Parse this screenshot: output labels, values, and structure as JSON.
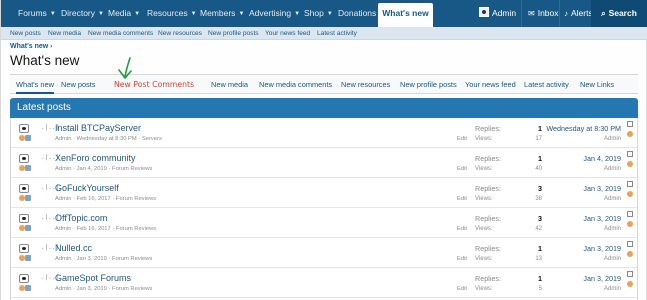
{
  "nav": {
    "items": [
      "Forums",
      "Directory",
      "Media",
      "Resources",
      "Members",
      "Advertising",
      "Shop",
      "Donations"
    ],
    "active": "What's new",
    "user": "Admin",
    "inbox": "Inbox",
    "alerts": "Alerts",
    "search": "Search"
  },
  "subnav": [
    "New posts",
    "New media",
    "New media comments",
    "New resources",
    "New profile posts",
    "Your news feed",
    "Latest activity"
  ],
  "breadcrumb": "What's new",
  "page_title": "What's new",
  "tabs": [
    "What's new",
    "New posts",
    "New media",
    "New media comments",
    "New resources",
    "New profile posts",
    "Your news feed",
    "Latest activity",
    "New Links"
  ],
  "annotation": "New Post Comments",
  "block_title": "Latest posts",
  "labels": {
    "replies": "Replies:",
    "views": "Views:",
    "edit": "Edit"
  },
  "threads": [
    {
      "prefix": ".|..|",
      "title": "Install BTCPayServer",
      "meta": "Admin · Wednesday at 8:30 PM · Servers",
      "replies": "1",
      "views": "17",
      "last_date": "Wednesday at 8:30 PM",
      "last_user": "Admin"
    },
    {
      "prefix": ".|..|",
      "title": "XenForo community",
      "meta": "Admin · Jan 4, 2019 · Forum Reviews",
      "replies": "1",
      "views": "40",
      "last_date": "Jan 4, 2019",
      "last_user": "Admin"
    },
    {
      "prefix": ".|..|",
      "title": "GoFuckYourself",
      "meta": "Admin · Feb 16, 2017 · Forum Reviews",
      "replies": "3",
      "views": "38",
      "last_date": "Jan 3, 2019",
      "last_user": "Admin"
    },
    {
      "prefix": ".|..|",
      "title": "OffTopic.com",
      "meta": "Admin · Feb 16, 2017 · Forum Reviews",
      "replies": "3",
      "views": "42",
      "last_date": "Jan 3, 2019",
      "last_user": "Admin"
    },
    {
      "prefix": ".|..|",
      "title": "Nulled.cc",
      "meta": "Admin · Jan 3, 2019 · Forum Reviews",
      "replies": "1",
      "views": "13",
      "last_date": "Jan 3, 2019",
      "last_user": "Admin"
    },
    {
      "prefix": ".|..|",
      "title": "GameSpot Forums",
      "meta": "Admin · Jan 3, 2019 · Forum Reviews",
      "replies": "1",
      "views": "5",
      "last_date": "Jan 3, 2019",
      "last_user": "Admin"
    }
  ]
}
